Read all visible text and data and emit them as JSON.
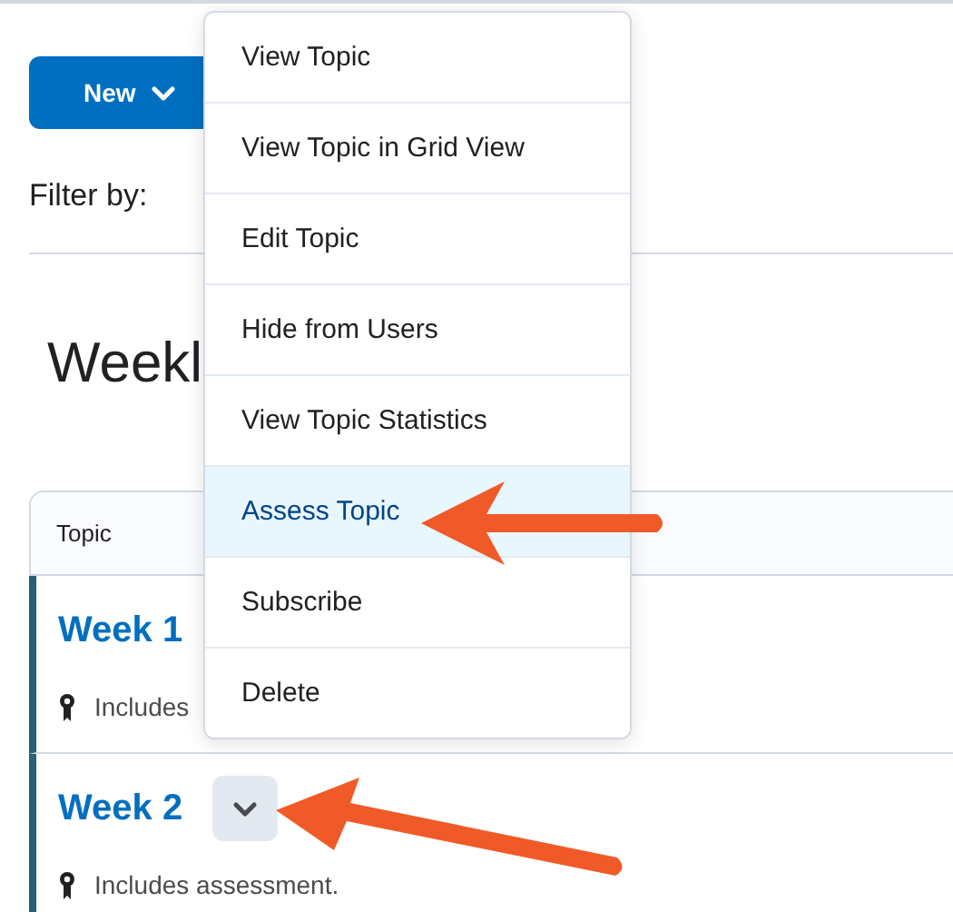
{
  "toolbar": {
    "new_button": "New",
    "filter_label": "Filter by:"
  },
  "heading": "Weekl",
  "table": {
    "columns": [
      "Topic"
    ],
    "rows": [
      {
        "title": "Week 1",
        "note": "Includes"
      },
      {
        "title": "Week 2",
        "note": "Includes assessment.",
        "has_menu_button": true
      }
    ]
  },
  "context_menu": {
    "items": [
      {
        "label": "View Topic",
        "selected": false
      },
      {
        "label": "View Topic in Grid View",
        "selected": false
      },
      {
        "label": "Edit Topic",
        "selected": false
      },
      {
        "label": "Hide from Users",
        "selected": false
      },
      {
        "label": "View Topic Statistics",
        "selected": false
      },
      {
        "label": "Assess Topic",
        "selected": true
      },
      {
        "label": "Subscribe",
        "selected": false
      },
      {
        "label": "Delete",
        "selected": false
      }
    ]
  }
}
